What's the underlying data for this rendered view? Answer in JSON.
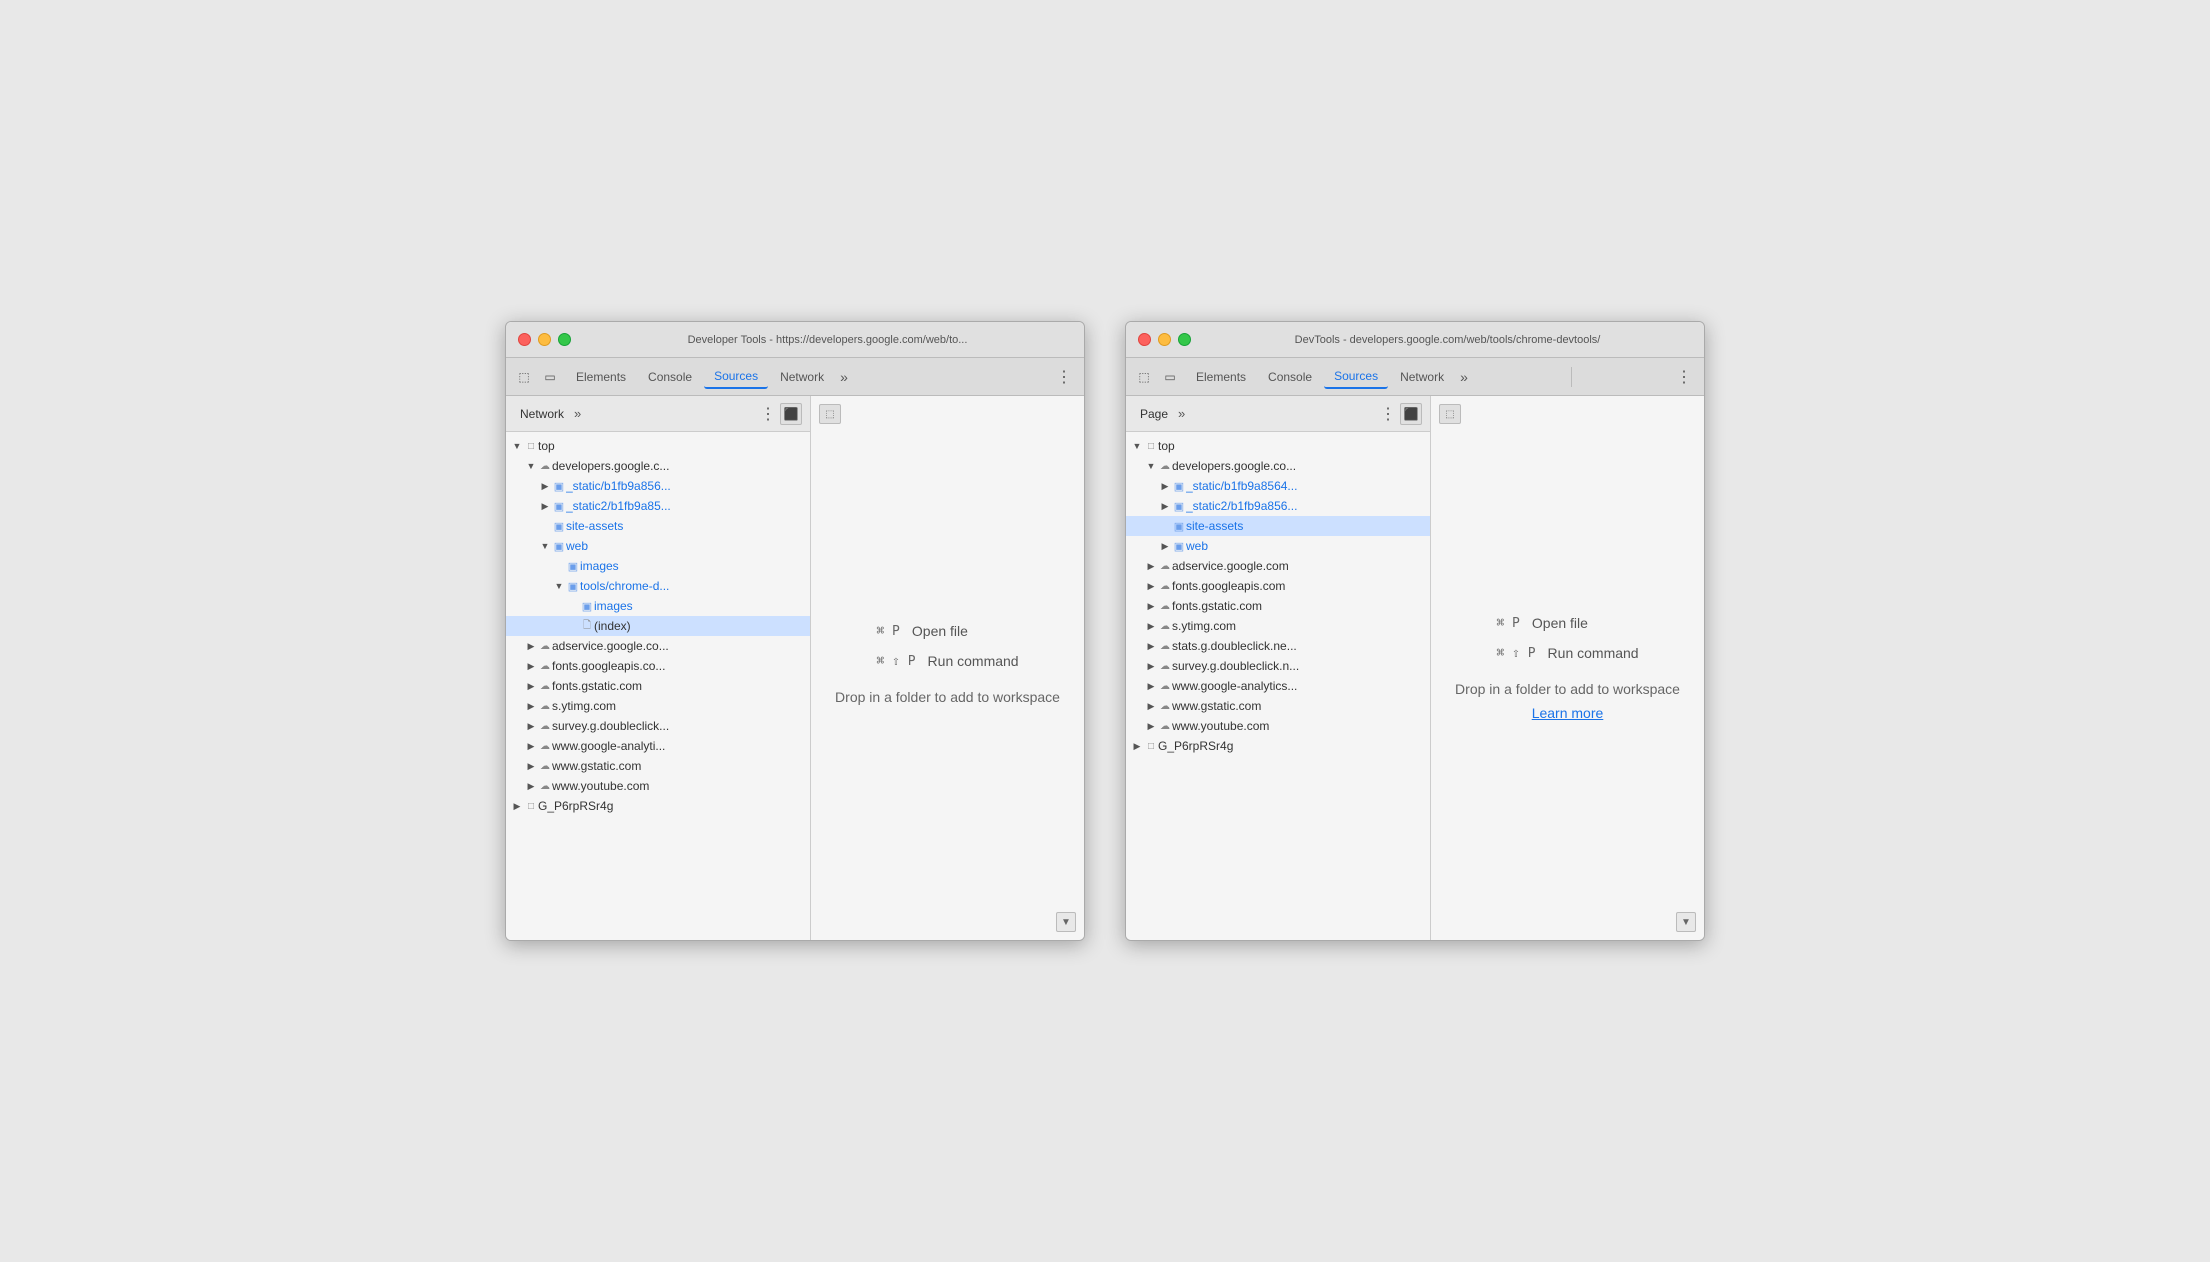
{
  "window1": {
    "title": "Developer Tools - https://developers.google.com/web/to...",
    "tabs": [
      "Elements",
      "Console",
      "Sources",
      "Network",
      "»"
    ],
    "active_tab": "Sources",
    "sidebar_tab": "Network",
    "tree": [
      {
        "label": "top",
        "indent": 0,
        "arrow": "expanded",
        "icon": "frame"
      },
      {
        "label": "developers.google.c...",
        "indent": 1,
        "arrow": "expanded",
        "icon": "cloud"
      },
      {
        "label": "_static/b1fb9a856...",
        "indent": 2,
        "arrow": "collapsed",
        "icon": "folder"
      },
      {
        "label": "_static2/b1fb9a85...",
        "indent": 2,
        "arrow": "collapsed",
        "icon": "folder"
      },
      {
        "label": "site-assets",
        "indent": 2,
        "arrow": "empty",
        "icon": "folder"
      },
      {
        "label": "web",
        "indent": 2,
        "arrow": "expanded",
        "icon": "folder"
      },
      {
        "label": "images",
        "indent": 3,
        "arrow": "empty",
        "icon": "folder"
      },
      {
        "label": "tools/chrome-d...",
        "indent": 3,
        "arrow": "expanded",
        "icon": "folder"
      },
      {
        "label": "images",
        "indent": 4,
        "arrow": "empty",
        "icon": "folder"
      },
      {
        "label": "(index)",
        "indent": 4,
        "arrow": "empty",
        "icon": "file",
        "selected": true
      },
      {
        "label": "adservice.google.co...",
        "indent": 1,
        "arrow": "collapsed",
        "icon": "cloud"
      },
      {
        "label": "fonts.googleapis.co...",
        "indent": 1,
        "arrow": "collapsed",
        "icon": "cloud"
      },
      {
        "label": "fonts.gstatic.com",
        "indent": 1,
        "arrow": "collapsed",
        "icon": "cloud"
      },
      {
        "label": "s.ytimg.com",
        "indent": 1,
        "arrow": "collapsed",
        "icon": "cloud"
      },
      {
        "label": "survey.g.doubleclick...",
        "indent": 1,
        "arrow": "collapsed",
        "icon": "cloud"
      },
      {
        "label": "www.google-analyti...",
        "indent": 1,
        "arrow": "collapsed",
        "icon": "cloud"
      },
      {
        "label": "www.gstatic.com",
        "indent": 1,
        "arrow": "collapsed",
        "icon": "cloud"
      },
      {
        "label": "www.youtube.com",
        "indent": 1,
        "arrow": "collapsed",
        "icon": "cloud"
      },
      {
        "label": "G_P6rpRSr4g",
        "indent": 0,
        "arrow": "collapsed",
        "icon": "frame"
      }
    ],
    "editor": {
      "open_file_kbd": "⌘ P",
      "open_file_label": "Open file",
      "run_cmd_kbd": "⌘ ⇧ P",
      "run_cmd_label": "Run command",
      "drop_text": "Drop in a folder to add to workspace",
      "learn_more": null
    }
  },
  "window2": {
    "title": "DevTools - developers.google.com/web/tools/chrome-devtools/",
    "tabs": [
      "Elements",
      "Console",
      "Sources",
      "Network",
      "»"
    ],
    "active_tab": "Sources",
    "sidebar_tab": "Page",
    "tree": [
      {
        "label": "top",
        "indent": 0,
        "arrow": "expanded",
        "icon": "frame"
      },
      {
        "label": "developers.google.co...",
        "indent": 1,
        "arrow": "expanded",
        "icon": "cloud"
      },
      {
        "label": "_static/b1fb9a8564...",
        "indent": 2,
        "arrow": "collapsed",
        "icon": "folder"
      },
      {
        "label": "_static2/b1fb9a856...",
        "indent": 2,
        "arrow": "collapsed",
        "icon": "folder"
      },
      {
        "label": "site-assets",
        "indent": 2,
        "arrow": "empty",
        "icon": "folder",
        "selected": true
      },
      {
        "label": "web",
        "indent": 2,
        "arrow": "collapsed",
        "icon": "folder"
      },
      {
        "label": "adservice.google.com",
        "indent": 1,
        "arrow": "collapsed",
        "icon": "cloud"
      },
      {
        "label": "fonts.googleapis.com",
        "indent": 1,
        "arrow": "collapsed",
        "icon": "cloud"
      },
      {
        "label": "fonts.gstatic.com",
        "indent": 1,
        "arrow": "collapsed",
        "icon": "cloud"
      },
      {
        "label": "s.ytimg.com",
        "indent": 1,
        "arrow": "collapsed",
        "icon": "cloud"
      },
      {
        "label": "stats.g.doubleclick.ne...",
        "indent": 1,
        "arrow": "collapsed",
        "icon": "cloud"
      },
      {
        "label": "survey.g.doubleclick.n...",
        "indent": 1,
        "arrow": "collapsed",
        "icon": "cloud"
      },
      {
        "label": "www.google-analytics...",
        "indent": 1,
        "arrow": "collapsed",
        "icon": "cloud"
      },
      {
        "label": "www.gstatic.com",
        "indent": 1,
        "arrow": "collapsed",
        "icon": "cloud"
      },
      {
        "label": "www.youtube.com",
        "indent": 1,
        "arrow": "collapsed",
        "icon": "cloud"
      },
      {
        "label": "G_P6rpRSr4g",
        "indent": 0,
        "arrow": "collapsed",
        "icon": "frame"
      }
    ],
    "editor": {
      "open_file_kbd": "⌘ P",
      "open_file_label": "Open file",
      "run_cmd_kbd": "⌘ ⇧ P",
      "run_cmd_label": "Run command",
      "drop_text": "Drop in a folder to add to workspace",
      "learn_more": "Learn more"
    }
  },
  "icons": {
    "inspect": "⬜",
    "device": "📱",
    "more_tabs": "»",
    "dots": "⋮",
    "panel": "⬛",
    "scroll_bottom": "⬇"
  }
}
